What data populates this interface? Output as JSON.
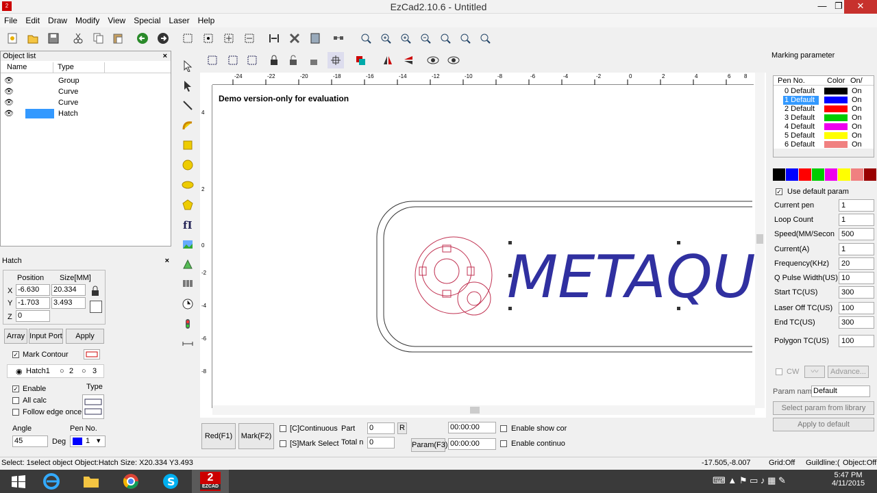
{
  "window": {
    "title": "EzCad2.10.6 - Untitled",
    "minimize": "—",
    "maximize": "❐",
    "close": "✕"
  },
  "menu": [
    "File",
    "Edit",
    "Draw",
    "Modify",
    "View",
    "Special",
    "Laser",
    "Help"
  ],
  "object_list": {
    "title": "Object list",
    "close": "×",
    "col_name": "Name",
    "col_type": "Type",
    "rows": [
      {
        "type": "Group"
      },
      {
        "type": "Curve"
      },
      {
        "type": "Curve"
      },
      {
        "type": "Hatch"
      }
    ]
  },
  "hatch": {
    "title": "Hatch",
    "close": "×",
    "position_label": "Position",
    "size_label": "Size[MM]",
    "x_label": "X",
    "y_label": "Y",
    "z_label": "Z",
    "x": "-6.630",
    "y": "-1.703",
    "z": "0",
    "w": "20.334",
    "h": "3.493",
    "array": "Array",
    "input_port": "Input Port",
    "apply": "Apply",
    "mark_contour": "Mark Contour",
    "hatch1": "Hatch1",
    "opt2": "2",
    "opt3": "3",
    "enable": "Enable",
    "type": "Type",
    "all_calc": "All calc",
    "follow_edge": "Follow edge once",
    "angle_label": "Angle",
    "angle": "45",
    "deg": "Deg",
    "pen_no_label": "Pen No.",
    "pen_no": "1"
  },
  "canvas": {
    "demo_text": "Demo version-only for evaluation",
    "logo_text": "METAQU",
    "ruler_top": [
      "-24",
      "-22",
      "-20",
      "-18",
      "-16",
      "-14",
      "-12",
      "-10",
      "-8",
      "-6",
      "-4",
      "-2",
      "0",
      "2",
      "4",
      "6",
      "8"
    ],
    "ruler_left": [
      "4",
      "2",
      "0",
      "-2",
      "-4",
      "-6",
      "-8"
    ]
  },
  "bottom": {
    "red": "Red(F1)",
    "mark": "Mark(F2)",
    "continuous": "[C]Continuous",
    "mark_select": "[S]Mark Select",
    "part": "Part",
    "part_val": "0",
    "r": "R",
    "total": "Total n",
    "total_val": "0",
    "time1": "00:00:00",
    "time2": "00:00:00",
    "param": "Param(F3)",
    "enable_show": "Enable show cor",
    "enable_cont": "Enable continuo"
  },
  "marking": {
    "title": "Marking parameter",
    "col_pen": "Pen No.",
    "col_color": "Color",
    "col_on": "On/",
    "pens": [
      {
        "label": "0 Default",
        "color": "#000000",
        "on": "On"
      },
      {
        "label": "1 Default",
        "color": "#0000ff",
        "on": "On"
      },
      {
        "label": "2 Default",
        "color": "#ff0000",
        "on": "On"
      },
      {
        "label": "3 Default",
        "color": "#00cc00",
        "on": "On"
      },
      {
        "label": "4 Default",
        "color": "#ee00ee",
        "on": "On"
      },
      {
        "label": "5 Default",
        "color": "#ffff00",
        "on": "On"
      },
      {
        "label": "6 Default",
        "color": "#f08080",
        "on": "On"
      }
    ],
    "palette": [
      "#000000",
      "#0000ff",
      "#ff0000",
      "#00cc00",
      "#ee00ee",
      "#ffff00",
      "#f08080",
      "#ff8000",
      "#990000"
    ],
    "use_default": "Use default param",
    "params": [
      {
        "label": "Current pen",
        "value": "1"
      },
      {
        "label": "Loop Count",
        "value": "1"
      },
      {
        "label": "Speed(MM/Secon",
        "value": "500"
      },
      {
        "label": "Current(A)",
        "value": "1"
      },
      {
        "label": "Frequency(KHz)",
        "value": "20"
      },
      {
        "label": "Q Pulse Width(US)",
        "value": "10"
      },
      {
        "label": "Start TC(US)",
        "value": "300"
      },
      {
        "label": "Laser Off TC(US)",
        "value": "100"
      },
      {
        "label": "End TC(US)",
        "value": "300"
      },
      {
        "label": "Polygon TC(US)",
        "value": "100"
      }
    ],
    "cw": "CW",
    "advance": "Advance...",
    "param_name_label": "Param name",
    "param_name": "Default",
    "select_lib": "Select param from library",
    "apply_default": "Apply to default"
  },
  "status": {
    "text": "Select: 1select object Object:Hatch Size: X20.334 Y3.493",
    "coords": "-17.505,-8.007",
    "grid": "Grid:Off",
    "guideline": "Guildline:(",
    "object": "Object:Off"
  },
  "taskbar": {
    "time": "5:47 PM",
    "date": "4/11/2015",
    "app_label": "EZCAD"
  }
}
